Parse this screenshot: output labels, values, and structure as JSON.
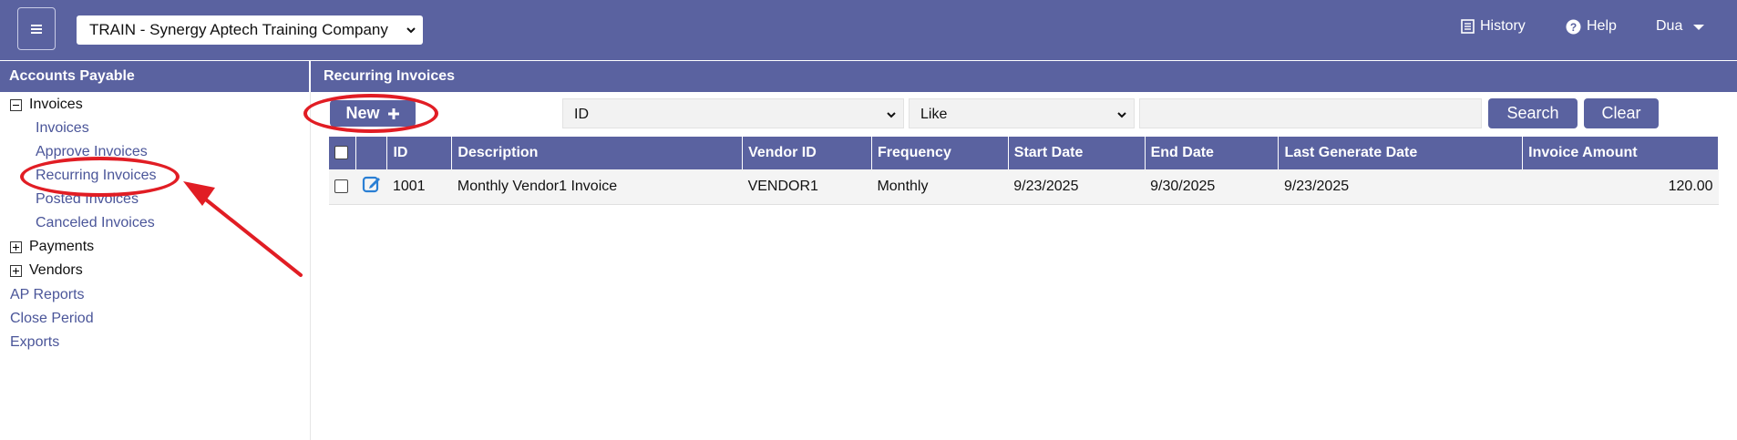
{
  "topbar": {
    "company": "TRAIN - Synergy Aptech Training Company",
    "history": "History",
    "help": "Help",
    "user": "Dua"
  },
  "sidebar": {
    "title": "Accounts Payable",
    "invoices": {
      "label": "Invoices",
      "children": [
        "Invoices",
        "Approve Invoices",
        "Recurring Invoices",
        "Posted Invoices",
        "Canceled Invoices"
      ]
    },
    "payments": "Payments",
    "vendors": "Vendors",
    "links": [
      "AP Reports",
      "Close Period",
      "Exports"
    ]
  },
  "main": {
    "title": "Recurring Invoices",
    "new_label": "New",
    "filter_field": "ID",
    "filter_op": "Like",
    "search_value": "",
    "search_label": "Search",
    "clear_label": "Clear"
  },
  "table": {
    "headers": [
      "ID",
      "Description",
      "Vendor ID",
      "Frequency",
      "Start Date",
      "End Date",
      "Last Generate Date",
      "Invoice Amount"
    ],
    "rows": [
      {
        "id": "1001",
        "description": "Monthly Vendor1 Invoice",
        "vendor_id": "VENDOR1",
        "frequency": "Monthly",
        "start_date": "9/23/2025",
        "end_date": "9/30/2025",
        "last_generate": "9/23/2025",
        "amount": "120.00"
      }
    ]
  },
  "colors": {
    "primary": "#5a62a0",
    "annotation": "#e11d24",
    "link": "#4a5599"
  }
}
